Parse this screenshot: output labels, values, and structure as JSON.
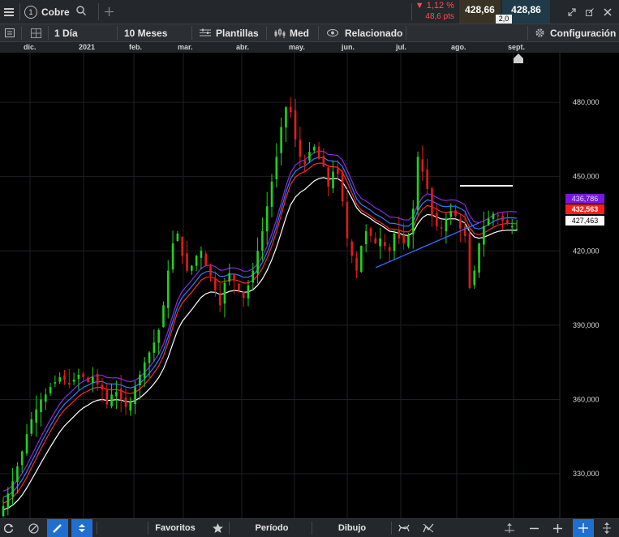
{
  "instrument": {
    "name": "Cobre",
    "number": "1"
  },
  "quote": {
    "change_pct": "▼ 1,12 %",
    "change_pts": "48,6 pts",
    "bid": "428,66",
    "ask": "428,86",
    "spread": "2,0",
    "colors": {
      "down": "#ff4d4d",
      "bid_bg": "#3b3226",
      "ask_bg": "#1f3a48"
    }
  },
  "toolbar": {
    "interval": "1 Día",
    "range": "10 Meses",
    "templates": "Plantillas",
    "price_type": "Med",
    "related": "Relacionado",
    "settings": "Configuración"
  },
  "dates": [
    "dic.",
    "2021",
    "feb.",
    "mar.",
    "abr.",
    "may.",
    "jun.",
    "jul.",
    "ago.",
    "sept."
  ],
  "price_tags": {
    "purple": "436,786",
    "red": "432,563",
    "white": "427,463"
  },
  "bottom": {
    "favorites": "Favoritos",
    "period": "Período",
    "drawing": "Dibujo"
  },
  "chart_data": {
    "type": "candlestick",
    "y_ticks": [
      "480,000",
      "450,000",
      "420,000",
      "390,000",
      "360,000",
      "330,000"
    ],
    "y_tick_values": [
      480000,
      450000,
      420000,
      390000,
      360000,
      330000
    ],
    "ylim": [
      312000,
      500000
    ],
    "grid": true,
    "up_color": "#1fd41f",
    "down_color": "#e11b1b",
    "x_labels": [
      "dic.",
      "2021",
      "feb.",
      "mar.",
      "abr.",
      "may.",
      "jun.",
      "jul.",
      "ago.",
      "sept."
    ],
    "closes": [
      317000,
      322000,
      327000,
      333000,
      339000,
      346000,
      352000,
      356000,
      360000,
      362000,
      365000,
      367000,
      369000,
      368000,
      366000,
      368000,
      370000,
      369000,
      367000,
      369000,
      366000,
      364000,
      358000,
      362000,
      363000,
      360000,
      357000,
      359000,
      365000,
      370000,
      375000,
      379000,
      383000,
      388000,
      398000,
      412000,
      423000,
      427000,
      418000,
      412000,
      414000,
      418000,
      420000,
      414000,
      410000,
      404000,
      398000,
      407000,
      411000,
      408000,
      404000,
      401000,
      406000,
      412000,
      420000,
      428000,
      438000,
      448000,
      458000,
      470000,
      478000,
      476000,
      465000,
      458000,
      455000,
      460000,
      462000,
      457000,
      454000,
      446000,
      452000,
      451000,
      440000,
      425000,
      418000,
      412000,
      422000,
      428000,
      426000,
      423000,
      425000,
      422000,
      420000,
      427000,
      425000,
      423000,
      426000,
      437000,
      458000,
      452000,
      445000,
      434000,
      430000,
      429000,
      433000,
      436000,
      434000,
      429000,
      426000,
      405000,
      412000,
      423000,
      430000,
      433000,
      435000,
      434000,
      432000,
      431000,
      430000,
      428760
    ],
    "ma_white_last": 427463,
    "ma_red_last": 432563,
    "ma_purple_last": 436786
  }
}
